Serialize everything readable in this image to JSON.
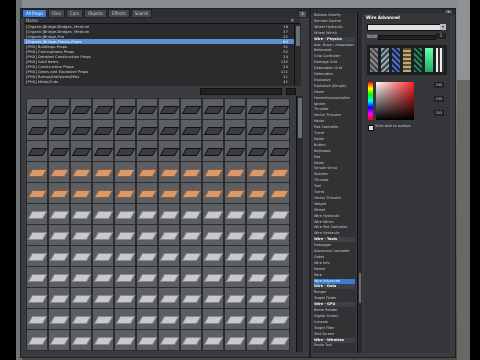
{
  "list_panel": {
    "tabs": [
      "All Props",
      "Files",
      "Cars",
      "Objects",
      "Effects",
      "Search"
    ],
    "col_name": "Name",
    "col_count": "#",
    "rows": [
      {
        "name": "[Organic]Bridge-Bridges, Medium",
        "n": "18"
      },
      {
        "name": "[Organic]Bridge-Bridges, Medium",
        "n": "37"
      },
      {
        "name": "[Organic]Bridge-Fire",
        "n": "21"
      },
      {
        "name": "[Organic]Bridge-Planks-Props",
        "n": "64"
      },
      {
        "name": "[PHX] Buildings-Props",
        "n": "31"
      },
      {
        "name": "[PHX] Contraptions-Props",
        "n": "52"
      },
      {
        "name": "[PHX] Detailed Construction Props",
        "n": "24"
      },
      {
        "name": "[PHX] Gold Items",
        "n": "132"
      },
      {
        "name": "[PHX] Construction Props",
        "n": "24"
      },
      {
        "name": "[PHX] Gears and Explosive Props",
        "n": "111"
      },
      {
        "name": "[PHX] Ramps/Halfpipes/Misc",
        "n": "21"
      },
      {
        "name": "[PHX] Metal/Cuts",
        "n": "41"
      }
    ]
  },
  "item_list": {
    "items": [
      {
        "label": "Balloon Gravity",
        "kind": "item"
      },
      {
        "label": "Remote Control",
        "kind": "item"
      },
      {
        "label": "Wheel Hydraulic",
        "kind": "item"
      },
      {
        "label": "Wheel Winch",
        "kind": "item"
      },
      {
        "label": "Wire - Physics",
        "kind": "hdr"
      },
      {
        "label": "Adv. Dupe / Adaptation",
        "kind": "item"
      },
      {
        "label": "Ballsocket",
        "kind": "item"
      },
      {
        "label": "Chip Controller",
        "kind": "item"
      },
      {
        "label": "Damage Grid",
        "kind": "item"
      },
      {
        "label": "Detonation Grid",
        "kind": "item"
      },
      {
        "label": "Detonation",
        "kind": "item"
      },
      {
        "label": "Explosive",
        "kind": "item"
      },
      {
        "label": "Explosive (Simple)",
        "kind": "item"
      },
      {
        "label": "Hover",
        "kind": "item"
      },
      {
        "label": "Hoverdrivecontroller",
        "kind": "item"
      },
      {
        "label": "Igniter",
        "kind": "item"
      },
      {
        "label": "Thruster",
        "kind": "item"
      },
      {
        "label": "Vector Thruster",
        "kind": "item"
      },
      {
        "label": "Nailer",
        "kind": "item"
      },
      {
        "label": "Pod Controller",
        "kind": "item"
      },
      {
        "label": "Turret",
        "kind": "item"
      },
      {
        "label": "Nailer",
        "kind": "item"
      },
      {
        "label": "Button",
        "kind": "item"
      },
      {
        "label": "Keyboard",
        "kind": "item"
      },
      {
        "label": "Pod",
        "kind": "item"
      },
      {
        "label": "Nailer",
        "kind": "item"
      },
      {
        "label": "Simple Servo",
        "kind": "item"
      },
      {
        "label": "Speaker",
        "kind": "item"
      },
      {
        "label": "Thruster",
        "kind": "item"
      },
      {
        "label": "Trail",
        "kind": "item"
      },
      {
        "label": "Turret",
        "kind": "item"
      },
      {
        "label": "Vector Thruster",
        "kind": "item"
      },
      {
        "label": "Weight",
        "kind": "item"
      },
      {
        "label": "Wheel",
        "kind": "item"
      },
      {
        "label": "Wire Hydraulic",
        "kind": "item"
      },
      {
        "label": "Wire Winch",
        "kind": "item"
      },
      {
        "label": "Wire Pod Controller",
        "kind": "item"
      },
      {
        "label": "Wire Hydraulic",
        "kind": "item"
      },
      {
        "label": "Wire - Tools",
        "kind": "hdr"
      },
      {
        "label": "Debugger",
        "kind": "item"
      },
      {
        "label": "Advanced Controller",
        "kind": "item"
      },
      {
        "label": "Gates",
        "kind": "item"
      },
      {
        "label": "Wire Info",
        "kind": "item"
      },
      {
        "label": "Namer",
        "kind": "item"
      },
      {
        "label": "Wire",
        "kind": "item"
      },
      {
        "label": "Wire Advanced",
        "kind": "sel"
      },
      {
        "label": "Wire - Data",
        "kind": "hdr"
      },
      {
        "label": "Ranger",
        "kind": "item"
      },
      {
        "label": "Target Finder",
        "kind": "item"
      },
      {
        "label": "Wire - GPU",
        "kind": "hdr"
      },
      {
        "label": "Beam Reader",
        "kind": "item"
      },
      {
        "label": "Digital Screen",
        "kind": "item"
      },
      {
        "label": "Console",
        "kind": "item"
      },
      {
        "label": "Target Filter",
        "kind": "item"
      },
      {
        "label": "Text Screen",
        "kind": "item"
      },
      {
        "label": "Wire - Wireless",
        "kind": "hdr"
      },
      {
        "label": "Radio Tool",
        "kind": "item"
      }
    ]
  },
  "settings_panel": {
    "title": "Wire Advanced",
    "width_label": "Width",
    "width_value": "1",
    "color_r": "255",
    "color_g": "255",
    "color_b": "255",
    "checkbox_label": "Stick wire to surface"
  }
}
